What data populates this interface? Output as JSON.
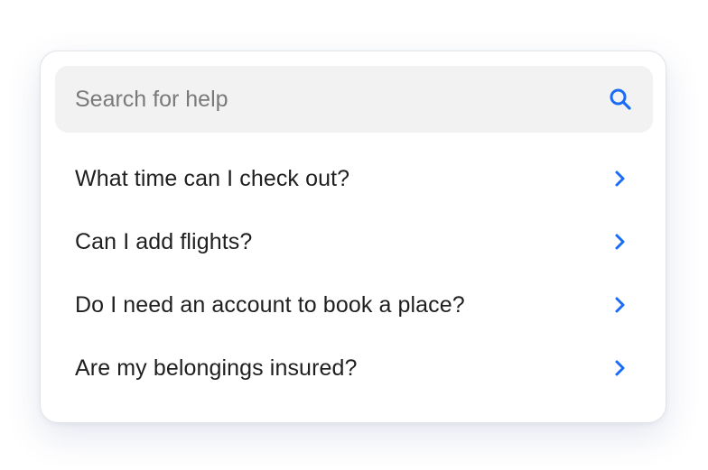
{
  "search": {
    "placeholder": "Search for help",
    "value": "",
    "icon": "search-icon"
  },
  "faq": {
    "items": [
      {
        "label": "What time can I check out?",
        "icon": "chevron-right-icon"
      },
      {
        "label": "Can I add flights?",
        "icon": "chevron-right-icon"
      },
      {
        "label": "Do I need an account to book a place?",
        "icon": "chevron-right-icon"
      },
      {
        "label": "Are my belongings insured?",
        "icon": "chevron-right-icon"
      }
    ]
  },
  "colors": {
    "accent": "#1a6cf5",
    "text": "#1f1f1f",
    "placeholder": "#7a7a7a",
    "search_bg": "#f2f2f2"
  }
}
